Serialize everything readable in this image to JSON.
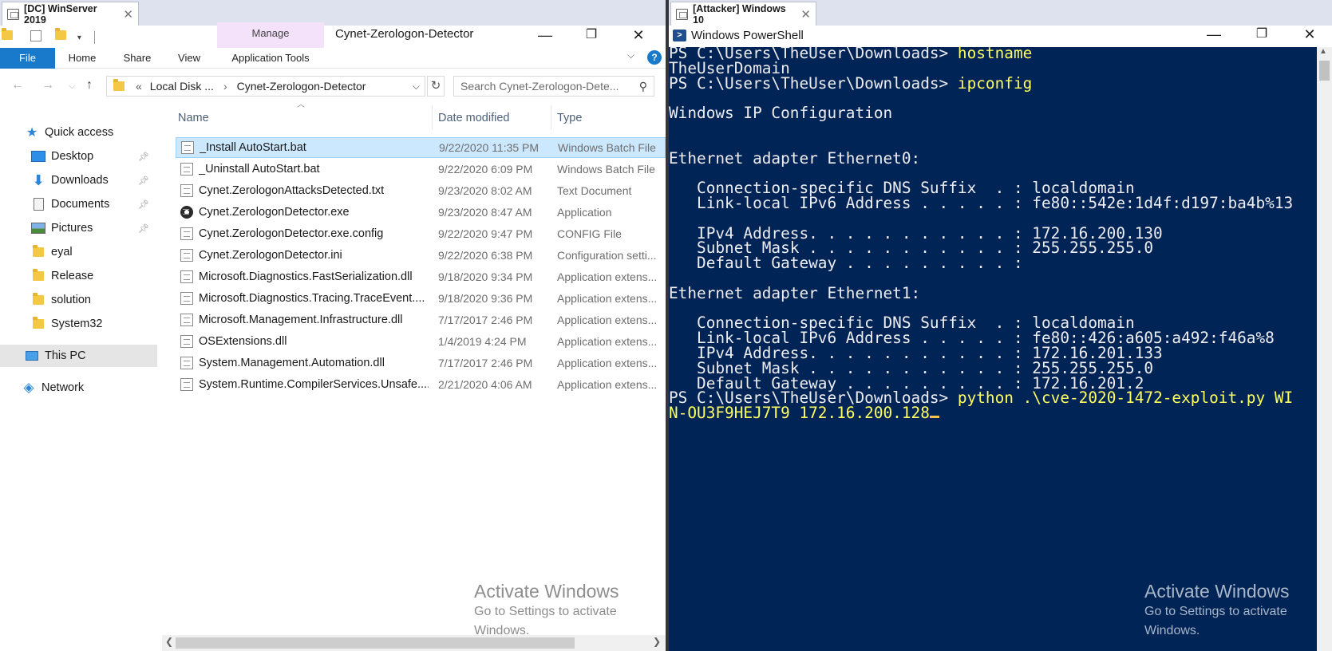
{
  "left_vm_tab": {
    "title": "[DC] WinServer 2019",
    "close": "✕"
  },
  "right_vm_tab": {
    "title": "[Attacker] Windows 10",
    "close": "✕"
  },
  "explorer": {
    "ribbon_context_group": "Manage",
    "window_title": "Cynet-Zerologon-Detector",
    "caption": {
      "minimize": "—",
      "restore": "❐",
      "close": "✕"
    },
    "tabs": {
      "file": "File",
      "home": "Home",
      "share": "Share",
      "view": "View",
      "app_tools": "Application Tools"
    },
    "help": "?",
    "breadcrumb": {
      "overflow": "«",
      "seg1": "Local Disk ...",
      "sep": "›",
      "seg2": "Cynet-Zerologon-Detector"
    },
    "search_placeholder": "Search Cynet-Zerologon-Dete...",
    "columns": {
      "name": "Name",
      "date": "Date modified",
      "type": "Type"
    },
    "nav": [
      {
        "label": "Quick access",
        "icon": "star-icon"
      },
      {
        "label": "Desktop",
        "icon": "desktop-icon",
        "pinned": true
      },
      {
        "label": "Downloads",
        "icon": "download-icon",
        "pinned": true
      },
      {
        "label": "Documents",
        "icon": "documents-icon",
        "pinned": true
      },
      {
        "label": "Pictures",
        "icon": "pictures-icon",
        "pinned": true
      },
      {
        "label": "eyal",
        "icon": "folder-icon"
      },
      {
        "label": "Release",
        "icon": "folder-icon"
      },
      {
        "label": "solution",
        "icon": "folder-icon"
      },
      {
        "label": "System32",
        "icon": "folder-icon"
      },
      {
        "label": "This PC",
        "icon": "pc-icon"
      },
      {
        "label": "Network",
        "icon": "network-icon"
      }
    ],
    "files": [
      {
        "name": "_Install AutoStart.bat",
        "date": "9/22/2020 11:35 PM",
        "type": "Windows Batch File"
      },
      {
        "name": "_Uninstall AutoStart.bat",
        "date": "9/22/2020 6:09 PM",
        "type": "Windows Batch File"
      },
      {
        "name": "Cynet.ZerologonAttacksDetected.txt",
        "date": "9/23/2020 8:02 AM",
        "type": "Text Document"
      },
      {
        "name": "Cynet.ZerologonDetector.exe",
        "date": "9/23/2020 8:47 AM",
        "type": "Application"
      },
      {
        "name": "Cynet.ZerologonDetector.exe.config",
        "date": "9/22/2020 9:47 PM",
        "type": "CONFIG File"
      },
      {
        "name": "Cynet.ZerologonDetector.ini",
        "date": "9/22/2020 6:38 PM",
        "type": "Configuration setti..."
      },
      {
        "name": "Microsoft.Diagnostics.FastSerialization.dll",
        "date": "9/18/2020 9:34 PM",
        "type": "Application extens..."
      },
      {
        "name": "Microsoft.Diagnostics.Tracing.TraceEvent....",
        "date": "9/18/2020 9:36 PM",
        "type": "Application extens..."
      },
      {
        "name": "Microsoft.Management.Infrastructure.dll",
        "date": "7/17/2017 2:46 PM",
        "type": "Application extens..."
      },
      {
        "name": "OSExtensions.dll",
        "date": "1/4/2019 4:24 PM",
        "type": "Application extens..."
      },
      {
        "name": "System.Management.Automation.dll",
        "date": "7/17/2017 2:46 PM",
        "type": "Application extens..."
      },
      {
        "name": "System.Runtime.CompilerServices.Unsafe....",
        "date": "2/21/2020 4:06 AM",
        "type": "Application extens..."
      }
    ]
  },
  "watermark": {
    "heading": "Activate Windows",
    "line1": "Go to Settings to activate",
    "line2": "Windows."
  },
  "powershell": {
    "title": "Windows PowerShell",
    "caption": {
      "minimize": "—",
      "restore": "❐",
      "close": "✕"
    },
    "lines": [
      {
        "prompt": "PS C:\\Users\\TheUser\\Downloads> ",
        "cmd": "hostname"
      },
      {
        "text": "TheUserDomain"
      },
      {
        "prompt": "PS C:\\Users\\TheUser\\Downloads> ",
        "cmd": "ipconfig"
      },
      {
        "text": ""
      },
      {
        "text": "Windows IP Configuration"
      },
      {
        "text": ""
      },
      {
        "text": ""
      },
      {
        "text": "Ethernet adapter Ethernet0:"
      },
      {
        "text": ""
      },
      {
        "text": "   Connection-specific DNS Suffix  . : localdomain"
      },
      {
        "text": "   Link-local IPv6 Address . . . . . : fe80::542e:1d4f:d197:ba4b%13"
      },
      {
        "text": ""
      },
      {
        "text": "   IPv4 Address. . . . . . . . . . . : 172.16.200.130"
      },
      {
        "text": "   Subnet Mask . . . . . . . . . . . : 255.255.255.0"
      },
      {
        "text": "   Default Gateway . . . . . . . . . :"
      },
      {
        "text": ""
      },
      {
        "text": "Ethernet adapter Ethernet1:"
      },
      {
        "text": ""
      },
      {
        "text": "   Connection-specific DNS Suffix  . : localdomain"
      },
      {
        "text": "   Link-local IPv6 Address . . . . . : fe80::426:a605:a492:f46a%8"
      },
      {
        "text": "   IPv4 Address. . . . . . . . . . . : 172.16.201.133"
      },
      {
        "text": "   Subnet Mask . . . . . . . . . . . : 255.255.255.0"
      },
      {
        "text": "   Default Gateway . . . . . . . . . : 172.16.201.2"
      },
      {
        "prompt": "PS C:\\Users\\TheUser\\Downloads> ",
        "cmd": "python .\\cve-2020-1472-exploit.py WI"
      },
      {
        "cmd": "N-OU3F9HEJ7T9 172.16.200.128",
        "cursor": true
      }
    ]
  },
  "colors": {
    "ps_bg": "#012456",
    "ps_cmd": "#ffff60",
    "ps_text": "#eeedf0",
    "accent": "#1979ca",
    "selection": "#cce8ff"
  }
}
